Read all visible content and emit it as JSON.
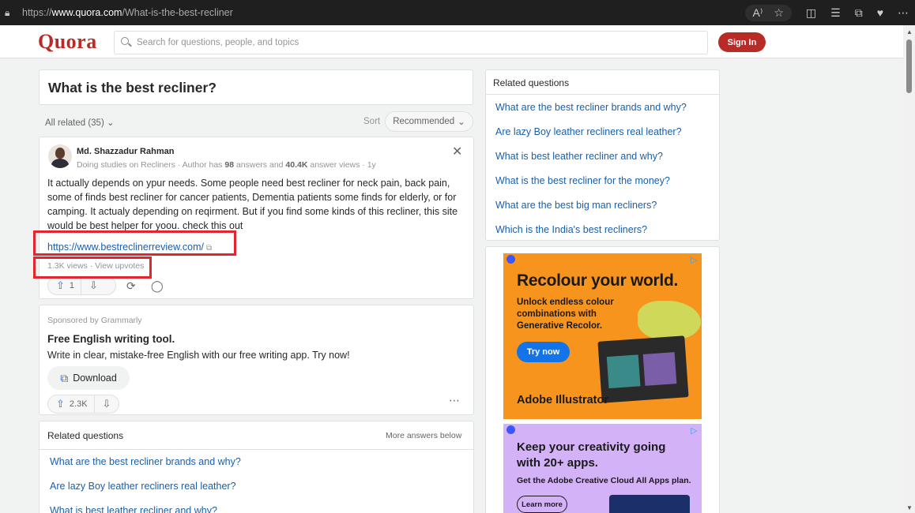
{
  "browser": {
    "url_prefix": "https://",
    "url_domain": "www.quora.com",
    "url_path": "/What-is-the-best-recliner"
  },
  "header": {
    "logo": "Quora",
    "search_placeholder": "Search for questions, people, and topics",
    "sign_in": "Sign In"
  },
  "question": {
    "title": "What is the best recliner?"
  },
  "filter": {
    "all_related": "All related (35)",
    "sort_label": "Sort",
    "sort_value": "Recommended"
  },
  "answer": {
    "author": "Md. Shazzadur Rahman",
    "credential_prefix": "Doing studies on Recliners · Author has ",
    "answers_count": "98",
    "credential_mid": " answers and ",
    "views_count": "40.4K",
    "credential_suffix": " answer views · 1y",
    "text": "It actually depends on ypur needs. Some people need best recliner for neck pain, back pain, some of finds best recliner for cancer patients, Dementia patients some finds for elderly, or for camping. It actualy depending on reqirment. But if you find some kinds of this recliner, this site would be best helper for yoou. check this out",
    "link": "https://www.bestreclinerreview.com/",
    "stats": "1.3K views · View upvotes",
    "upvotes": "1"
  },
  "ad": {
    "sponsor": "Sponsored by Grammarly",
    "title": "Free English writing tool.",
    "description": "Write in clear, mistake-free English with our free writing app. Try now!",
    "button": "Download",
    "upvotes": "2.3K"
  },
  "related_main": {
    "title": "Related questions",
    "more": "More answers below",
    "items": [
      "What are the best recliner brands and why?",
      "Are lazy Boy leather recliners real leather?",
      "What is best leather recliner and why?"
    ]
  },
  "sidebar": {
    "title": "Related questions",
    "items": [
      "What are the best recliner brands and why?",
      "Are lazy Boy leather recliners real leather?",
      "What is best leather recliner and why?",
      "What is the best recliner for the money?",
      "What are the best big man recliners?",
      "Which is the India's best recliners?"
    ]
  },
  "adobe_ad1": {
    "headline": "Recolour your world.",
    "sub": "Unlock endless colour combinations with Generative Recolor.",
    "button": "Try now",
    "brand": "Adobe Illustrator"
  },
  "adobe_ad2": {
    "headline": "Keep your creativity going with 20+ apps.",
    "sub": "Get the Adobe Creative Cloud All Apps plan.",
    "button": "Learn more"
  },
  "colors": {
    "brand": "#b92b27",
    "link": "#195faa",
    "highlight": "#e5252d"
  }
}
